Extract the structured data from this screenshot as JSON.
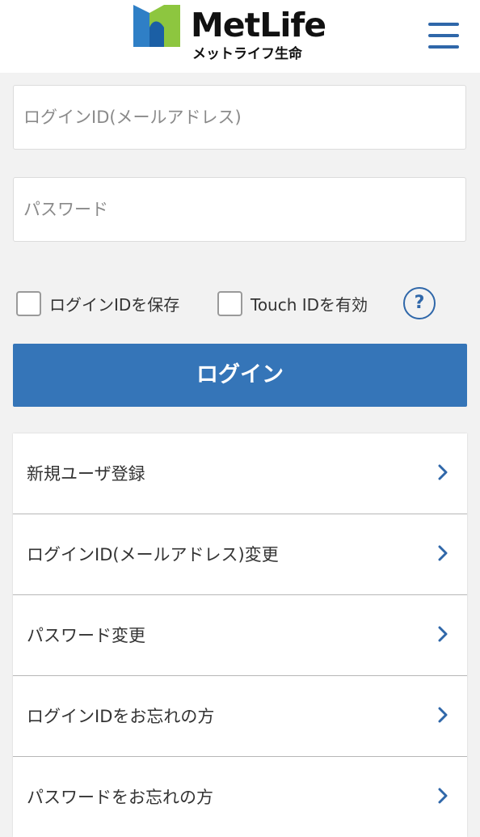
{
  "header": {
    "brand_name": "MetLife",
    "brand_sub": "メットライフ生命",
    "menu_icon": "hamburger-menu-icon",
    "colors": {
      "logo_blue": "#2f7fc6",
      "logo_green": "#8dc63f",
      "logo_dark": "#1b5fa5",
      "accent": "#2f67a9"
    }
  },
  "login": {
    "id_placeholder": "ログインID(メールアドレス)",
    "password_placeholder": "パスワード",
    "save_id_label": "ログインIDを保存",
    "touch_id_label": "Touch IDを有効",
    "help_label": "?",
    "submit_label": "ログイン",
    "button_color": "#3575b8"
  },
  "menu": {
    "items": [
      {
        "label": "新規ユーザ登録"
      },
      {
        "label": "ログインID(メールアドレス)変更"
      },
      {
        "label": "パスワード変更"
      },
      {
        "label": "ログインIDをお忘れの方"
      },
      {
        "label": "パスワードをお忘れの方"
      }
    ],
    "chevron_icon": "chevron-right-icon"
  }
}
